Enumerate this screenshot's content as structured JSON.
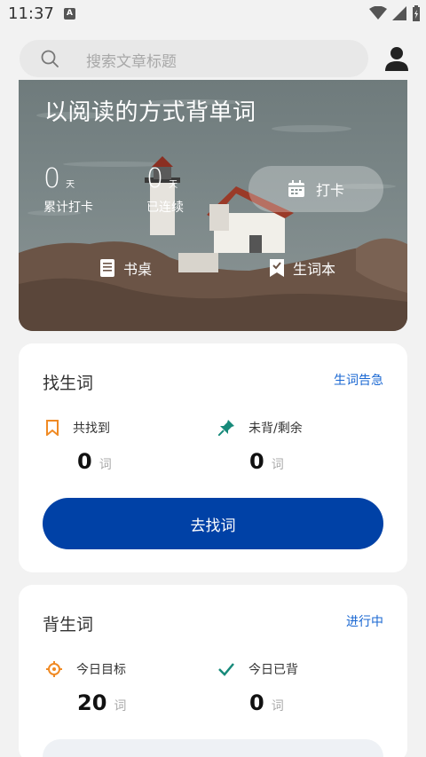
{
  "status": {
    "time": "11:37",
    "notification_badge": "A"
  },
  "search": {
    "placeholder": "搜索文章标题",
    "icon": "search-icon"
  },
  "header": {
    "avatar_icon": "person-icon"
  },
  "hero": {
    "title": "以阅读的方式背单词",
    "stats": [
      {
        "value": "0",
        "unit": "天",
        "label": "累计打卡"
      },
      {
        "value": "0",
        "unit": "天",
        "label": "已连续"
      }
    ],
    "checkin_label": "打卡",
    "nav": {
      "desk_label": "书桌",
      "wordbook_label": "生词本"
    }
  },
  "find_words": {
    "title": "找生词",
    "link": "生词告急",
    "found": {
      "label": "共找到",
      "value": "0",
      "unit": "词"
    },
    "remaining": {
      "label": "未背/剩余",
      "value": "0",
      "unit": "词"
    },
    "button": "去找词"
  },
  "study_words": {
    "title": "背生词",
    "link": "进行中",
    "target": {
      "label": "今日目标",
      "value": "20",
      "unit": "词"
    },
    "done": {
      "label": "今日已背",
      "value": "0",
      "unit": "词"
    }
  },
  "colors": {
    "accent": "#0041a6",
    "link": "#1967d2",
    "orange": "#f08a24",
    "teal": "#178a7a"
  }
}
